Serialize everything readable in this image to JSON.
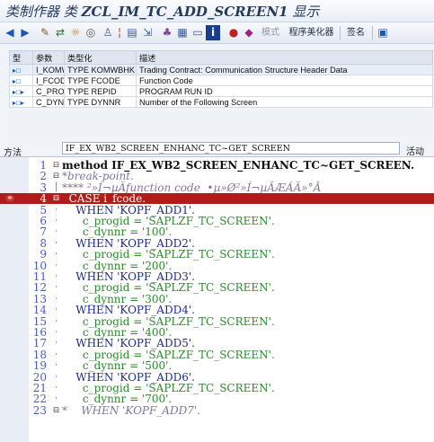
{
  "window": {
    "title_prefix": "类制作器 类",
    "title_class": "ZCL_IM_TC_ADD_SCREEN1",
    "title_suffix": "显示"
  },
  "toolbar": {
    "icons": [
      "back-arrow-icon",
      "forward-arrow-icon",
      "other-object-icon",
      "display-change-icon",
      "activate-icon",
      "where-used-icon",
      "object-list-icon",
      "enhance-icon",
      "navigate-icon",
      "hierarchy-icon",
      "block-icon",
      "screen-icon",
      "info-icon",
      "red-object-icon",
      "local-class-icon"
    ],
    "pattern_label": "模式",
    "pretty_printer_label": "程序美化器",
    "signature_label": "签名"
  },
  "params": {
    "headers": [
      "型",
      "参数",
      "类型化",
      "描述"
    ],
    "rows": [
      {
        "kind": "importing-icon",
        "name": "I_KOMWBHK",
        "typing": "TYPE KOMWBHK",
        "desc": "Trading Contract: Communication Structure Header Data"
      },
      {
        "kind": "importing-icon",
        "name": "I_FCODE",
        "typing": "TYPE FCODE",
        "desc": "Function Code"
      },
      {
        "kind": "changing-icon",
        "name": "C_PROGID",
        "typing": "TYPE REPID",
        "desc": "PROGRAM RUN ID"
      },
      {
        "kind": "changing-icon",
        "name": "C_DYNNR",
        "typing": "TYPE DYNNR",
        "desc": "Number of the Following Screen"
      }
    ]
  },
  "method": {
    "label": "方法",
    "name": "IF_EX_WB2_SCREEN_ENHANC_TC~GET_SCREEN",
    "status": "活动"
  },
  "code": {
    "highlight_line": 4,
    "breakpoint_line": 4,
    "lines": [
      {
        "n": "1",
        "fold": "⊟",
        "text": "method IF_EX_WB2_SCREEN_ENHANC_TC~GET_SCREEN.",
        "style": "black"
      },
      {
        "n": "2",
        "fold": "⊟",
        "text": "*break-point.",
        "style": "comment"
      },
      {
        "n": "3",
        "fold": "│",
        "text": "**** ²»Í¬µÄfunction code  •µ»Ø²»Í¬µÄÆÁÄ»°Â",
        "style": "comment"
      },
      {
        "n": "4",
        "fold": "⊟",
        "text": "  CASE i_fcode.",
        "style": "blue"
      },
      {
        "n": "5",
        "fold": "",
        "text": "    WHEN 'KOPF_ADD1'.",
        "style": "blue"
      },
      {
        "n": "6",
        "fold": "",
        "text": "      c_progid = 'SAPLZF_TC_SCREEN'.",
        "style": "string"
      },
      {
        "n": "7",
        "fold": "",
        "text": "      c_dynnr = '100'.",
        "style": "string"
      },
      {
        "n": "8",
        "fold": "",
        "text": "    WHEN 'KOPF_ADD2'.",
        "style": "blue"
      },
      {
        "n": "9",
        "fold": "",
        "text": "      c_progid = 'SAPLZF_TC_SCREEN'.",
        "style": "string"
      },
      {
        "n": "10",
        "fold": "",
        "text": "      c_dynnr = '200'.",
        "style": "string"
      },
      {
        "n": "11",
        "fold": "",
        "text": "    WHEN 'KOPF_ADD3'.",
        "style": "blue"
      },
      {
        "n": "12",
        "fold": "",
        "text": "      c_progid = 'SAPLZF_TC_SCREEN'.",
        "style": "string"
      },
      {
        "n": "13",
        "fold": "",
        "text": "      c_dynnr = '300'.",
        "style": "string"
      },
      {
        "n": "14",
        "fold": "",
        "text": "    WHEN 'KOPF_ADD4'.",
        "style": "blue"
      },
      {
        "n": "15",
        "fold": "",
        "text": "      c_progid = 'SAPLZF_TC_SCREEN'.",
        "style": "string"
      },
      {
        "n": "16",
        "fold": "",
        "text": "      c_dynnr = '400'.",
        "style": "string"
      },
      {
        "n": "17",
        "fold": "",
        "text": "    WHEN 'KOPF_ADD5'.",
        "style": "blue"
      },
      {
        "n": "18",
        "fold": "",
        "text": "      c_progid = 'SAPLZF_TC_SCREEN'.",
        "style": "string"
      },
      {
        "n": "19",
        "fold": "",
        "text": "      c_dynnr = '500'.",
        "style": "string"
      },
      {
        "n": "20",
        "fold": "",
        "text": "    WHEN 'KOPF_ADD6'.",
        "style": "blue"
      },
      {
        "n": "21",
        "fold": "",
        "text": "      c_progid = 'SAPLZF_TC_SCREEN'.",
        "style": "string"
      },
      {
        "n": "22",
        "fold": "",
        "text": "      c_dynnr = '700'.",
        "style": "string"
      },
      {
        "n": "23",
        "fold": "⊟",
        "text": "*    WHEN 'KOPF_ADD7'.",
        "style": "comment"
      }
    ]
  }
}
